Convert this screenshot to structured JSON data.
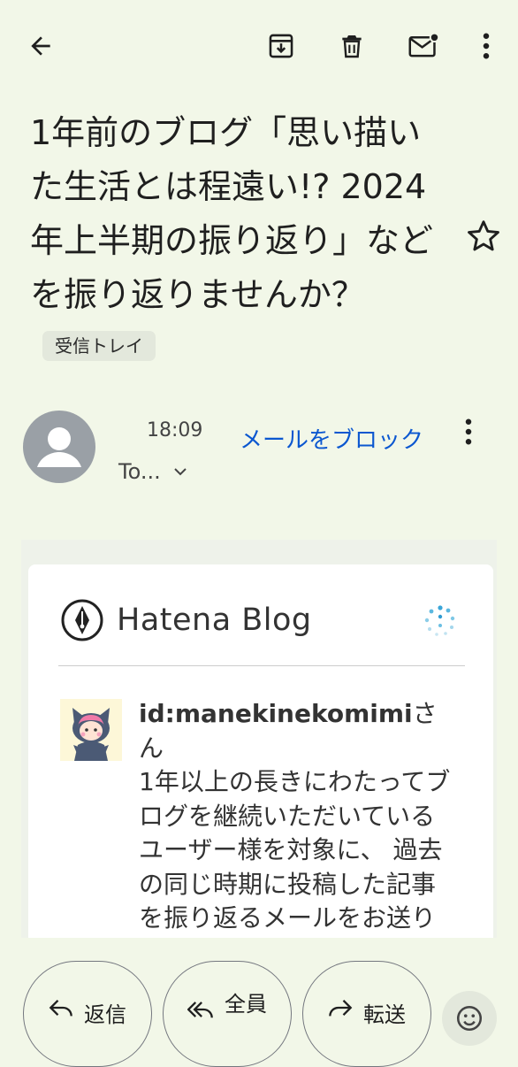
{
  "toolbar": {
    "back_icon": "arrow-back-icon",
    "archive_icon": "archive-icon",
    "delete_icon": "trash-icon",
    "mark_unread_icon": "mark-unread-icon",
    "more_icon": "more-vert-icon"
  },
  "email": {
    "subject": "1年前のブログ「思い描いた生活とは程遠い!? 2024年上半期の振り返り」などを振り返りませんか？",
    "label": "受信トレイ",
    "starred": false,
    "time": "18:09",
    "to": "To...",
    "block_label": "メールをブロック"
  },
  "body": {
    "brand": "Hatena Blog",
    "user_id": "id:manekinekomimi",
    "user_suffix": "さん",
    "message": "1年以上の長きにわたってブログを継続いただいているユーザー様を対象に、 過去の同じ時期に投稿した記事を振り返るメールをお送りします。"
  },
  "actions": {
    "reply": "返信",
    "reply_all": "全員",
    "forward": "転送",
    "emoji_icon": "add-emoji-icon"
  },
  "colors": {
    "background": "#f2f7e8",
    "link": "#0b57d0",
    "chip": "#e3e8dc"
  }
}
